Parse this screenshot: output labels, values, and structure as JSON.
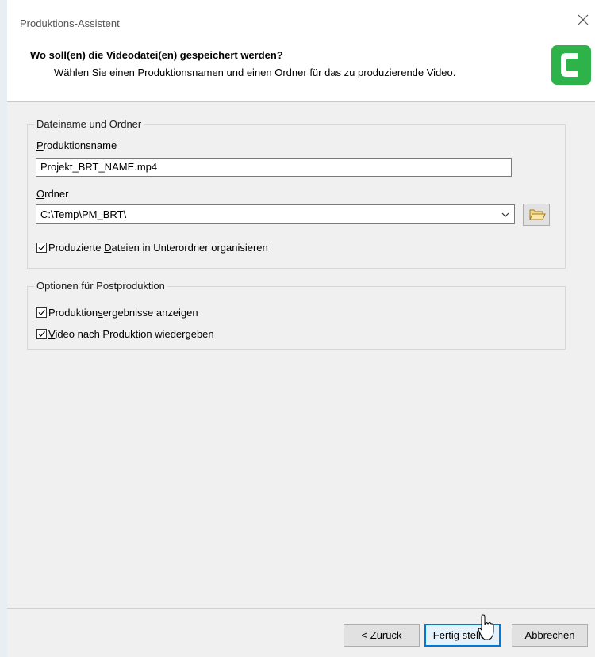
{
  "window": {
    "title": "Produktions-Assistent"
  },
  "header": {
    "title": "Wo soll(en) die Videodatei(en) gespeichert werden?",
    "subtitle": "Wählen Sie einen Produktionsnamen und einen Ordner für das zu produzierende Video."
  },
  "file_group": {
    "legend": "Dateiname und Ordner",
    "production_name_label_mnemonic": "P",
    "production_name_label_rest": "roduktionsname",
    "production_name_value": "Projekt_BRT_NAME.mp4",
    "folder_label_mnemonic": "O",
    "folder_label_rest": "rdner",
    "folder_value": "C:\\Temp\\PM_BRT\\",
    "organize_checkbox": {
      "checked": true,
      "label_before": "Produzierte ",
      "label_mnemonic": "D",
      "label_after": "ateien in Unterordner organisieren"
    }
  },
  "post_group": {
    "legend": "Optionen für Postproduktion",
    "show_results_checkbox": {
      "checked": true,
      "label_before": "Produktion",
      "label_mnemonic": "s",
      "label_after": "ergebnisse anzeigen"
    },
    "play_video_checkbox": {
      "checked": true,
      "label_before": "",
      "label_mnemonic": "V",
      "label_after": "ideo nach Produktion wiedergeben"
    }
  },
  "buttons": {
    "back_prefix": "< ",
    "back_mnemonic": "Z",
    "back_rest": "urück",
    "finish": "Fertig stellen",
    "cancel": "Abbrechen"
  },
  "colors": {
    "logo_green": "#2db34a",
    "primary_border": "#0078d7"
  }
}
